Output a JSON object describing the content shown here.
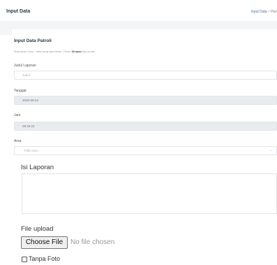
{
  "header": {
    "title": "Input Data",
    "breadcrumb": {
      "link": "Input Data",
      "separator": "/",
      "current": "Peri"
    }
  },
  "form": {
    "title": "Input Data Patroli",
    "hint_prefix": "Masukkan Data - data yang diperlukan, Tekan",
    "hint_bold": "Simpan",
    "hint_suffix": "jika sudah",
    "judul_label": "Judul Laporan",
    "judul_placeholder": "Judul",
    "tanggal_label": "Tanggal",
    "tanggal_value": "2020-09-04",
    "jam_label": "Jam",
    "jam_value": "09:29:22",
    "area_label": "Area",
    "area_selected": "- Pilih Area -",
    "isi_label": "Isi Laporan",
    "isi_value": "",
    "upload_label": "File upload",
    "choose_file": "Choose File",
    "no_file": "No file chosen",
    "tanpa_foto": "Tanpa Foto"
  }
}
